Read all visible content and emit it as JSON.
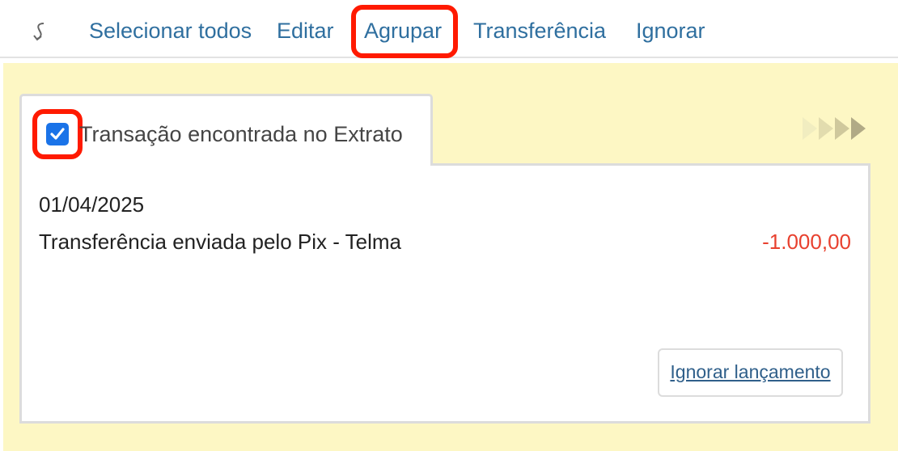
{
  "toolbar": {
    "back_icon": "return-arrow-icon",
    "items": [
      {
        "label": "Selecionar todos"
      },
      {
        "label": "Editar"
      },
      {
        "label": "Agrupar"
      },
      {
        "label": "Transferência"
      },
      {
        "label": "Ignorar"
      }
    ]
  },
  "colors": {
    "link": "#2f6f9f",
    "panel_bg": "#fdf7c4",
    "highlight": "#ff1a00",
    "checkbox": "#1a73e8",
    "negative_amount": "#e8412f"
  },
  "card": {
    "checked": true,
    "tab_title": "Transação encontrada no Extrato",
    "arrows_icon": "fast-forward-arrows-icon",
    "date": "01/04/2025",
    "description": "Transferência enviada pelo Pix - Telma",
    "amount": "-1.000,00",
    "ignore_button_label": "Ignorar lançamento"
  }
}
